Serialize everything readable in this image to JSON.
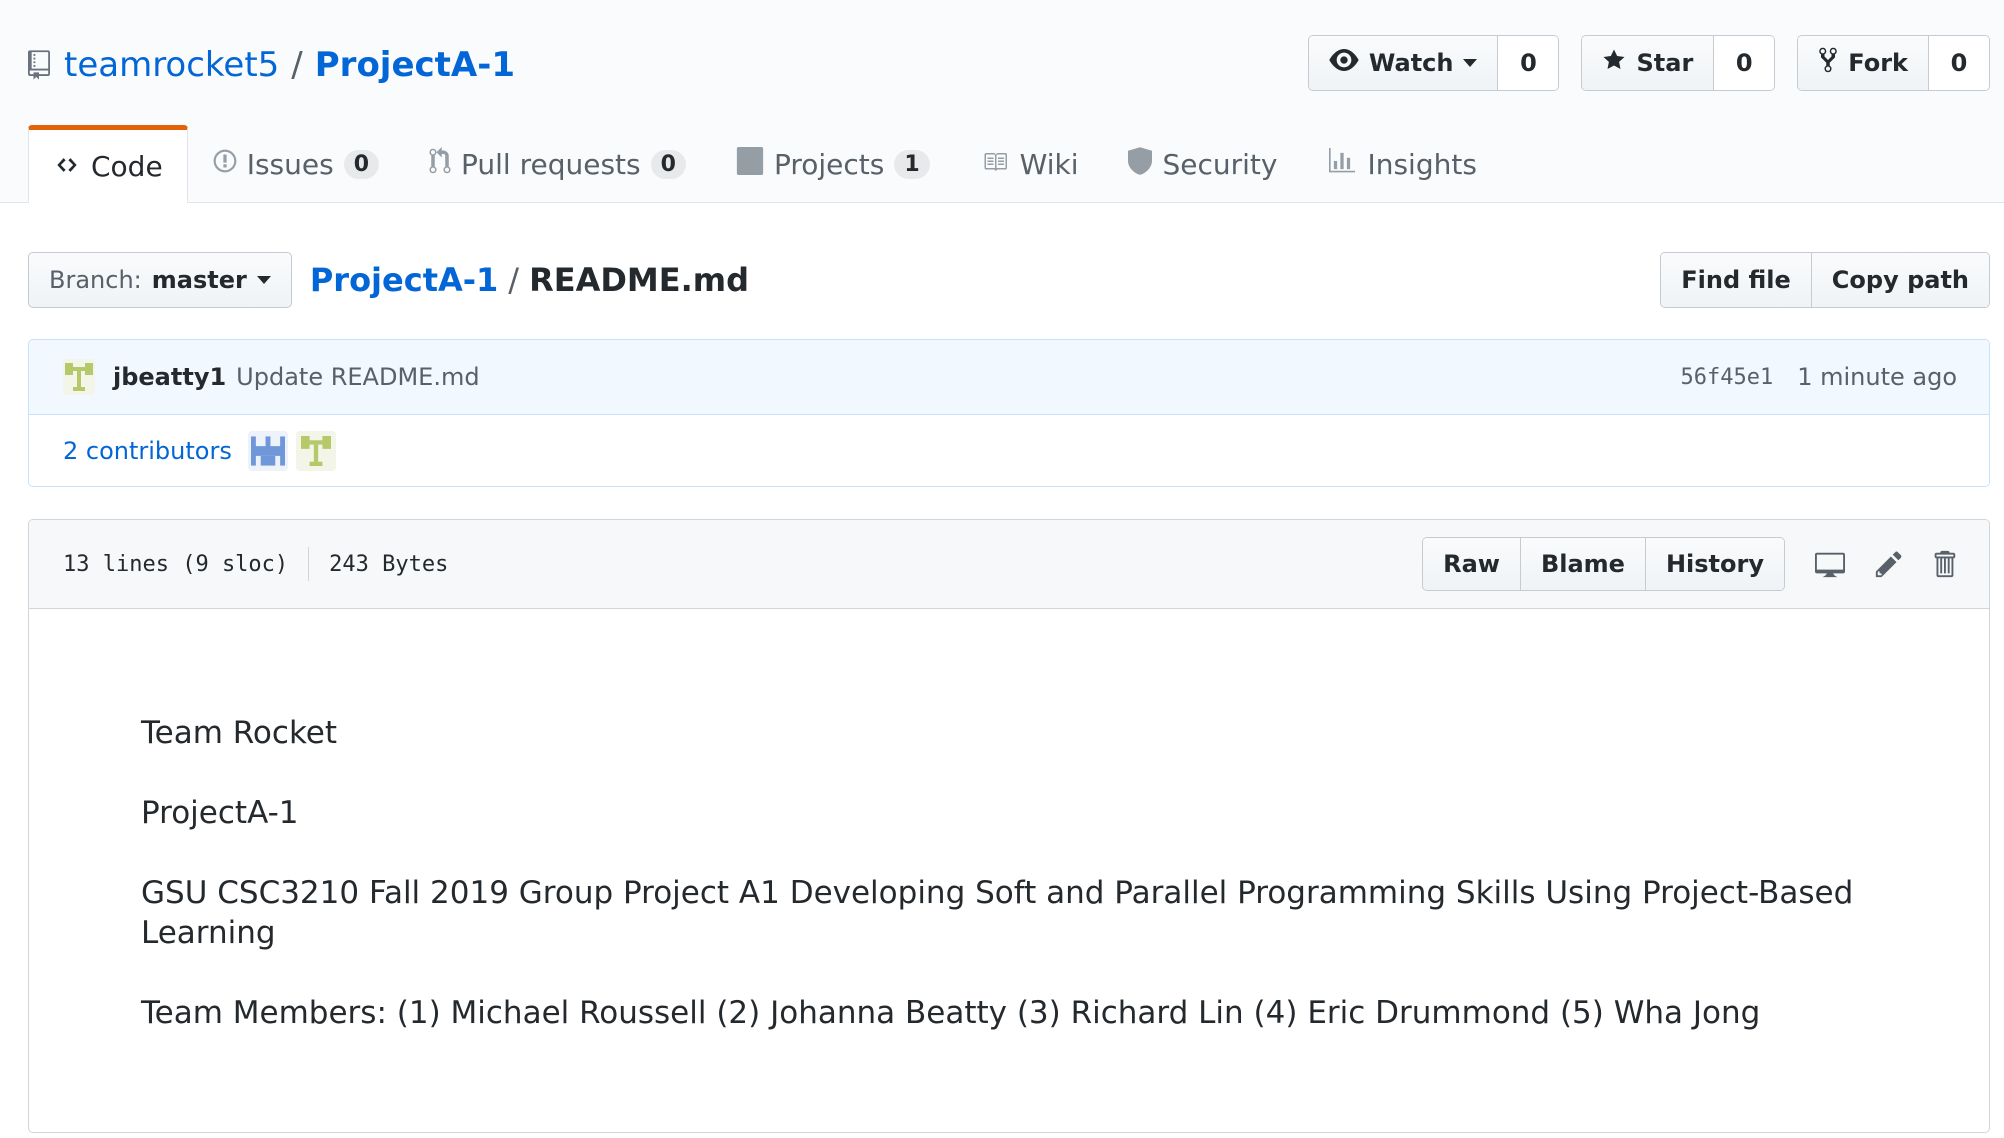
{
  "repo": {
    "owner": "teamrocket5",
    "separator": "/",
    "name": "ProjectA-1"
  },
  "actions": {
    "watch": {
      "label": "Watch",
      "count": "0"
    },
    "star": {
      "label": "Star",
      "count": "0"
    },
    "fork": {
      "label": "Fork",
      "count": "0"
    }
  },
  "tabs": [
    {
      "label": "Code",
      "icon": "code-icon",
      "selected": true
    },
    {
      "label": "Issues",
      "counter": "0",
      "icon": "issue-icon"
    },
    {
      "label": "Pull requests",
      "counter": "0",
      "icon": "pull-request-icon"
    },
    {
      "label": "Projects",
      "counter": "1",
      "icon": "project-icon"
    },
    {
      "label": "Wiki",
      "icon": "book-icon"
    },
    {
      "label": "Security",
      "icon": "shield-icon"
    },
    {
      "label": "Insights",
      "icon": "graph-icon"
    }
  ],
  "branch": {
    "prefix": "Branch:",
    "name": "master"
  },
  "path": {
    "repo": "ProjectA-1",
    "separator": "/",
    "file": "README.md"
  },
  "file_nav": {
    "find_file": "Find file",
    "copy_path": "Copy path"
  },
  "commit": {
    "author": "jbeatty1",
    "message": "Update README.md",
    "sha": "56f45e1",
    "time": "1 minute ago",
    "contributors": "2 contributors"
  },
  "file": {
    "lines": "13 lines (9 sloc)",
    "size": "243 Bytes",
    "raw": "Raw",
    "blame": "Blame",
    "history": "History"
  },
  "readme": {
    "line1": "Team Rocket",
    "line2": "ProjectA-1",
    "line3": "GSU CSC3210 Fall 2019 Group Project A1 Developing Soft and Parallel Programming Skills Using Project-Based Learning",
    "line4": "Team Members: (1) Michael Roussell (2) Johanna Beatty (3) Richard Lin (4) Eric Drummond (5) Wha Jong"
  },
  "colors": {
    "link": "#0366d6",
    "accent_tab": "#e36209",
    "commit_bg": "#f1f8ff"
  }
}
